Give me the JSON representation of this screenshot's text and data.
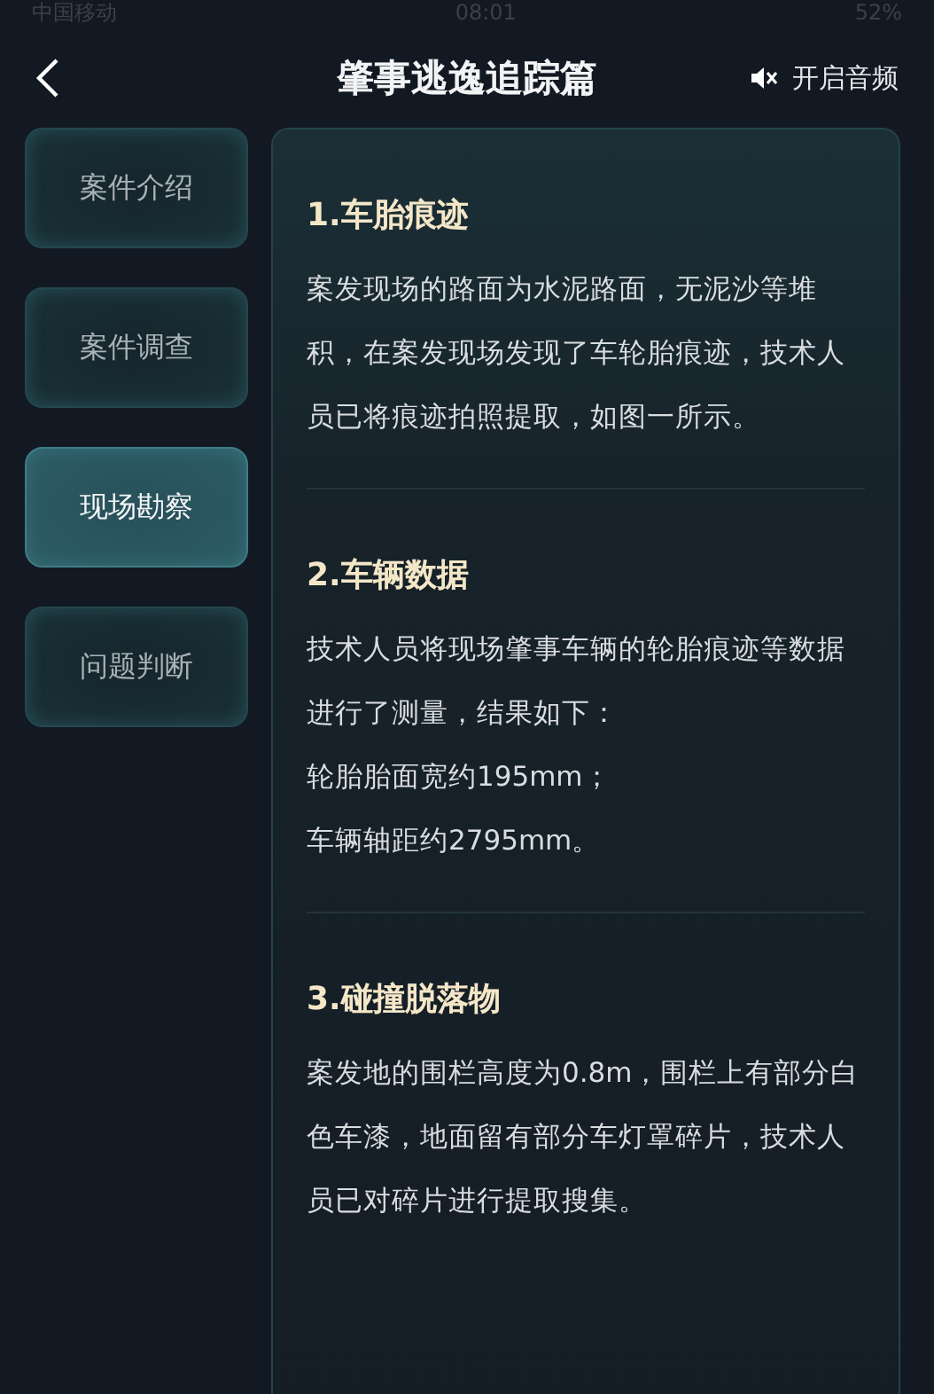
{
  "status_bar": {
    "carrier": "中国移动",
    "time": "08:01",
    "battery": "52%"
  },
  "header": {
    "title": "肇事逃逸追踪篇",
    "audio_label": "开启音频",
    "audio_on": false
  },
  "sidebar": {
    "items": [
      {
        "label": "案件介绍",
        "selected": false
      },
      {
        "label": "案件调查",
        "selected": false
      },
      {
        "label": "现场勘察",
        "selected": true
      },
      {
        "label": "问题判断",
        "selected": false
      }
    ]
  },
  "sections": [
    {
      "title": "1.车胎痕迹",
      "paragraphs": [
        "案发现场的路面为水泥路面，无泥沙等堆积，在案发现场发现了车轮胎痕迹，技术人员已将痕迹拍照提取，如图一所示。"
      ]
    },
    {
      "title": "2.车辆数据",
      "paragraphs": [
        "技术人员将现场肇事车辆的轮胎痕迹等数据进行了测量，结果如下：",
        "轮胎胎面宽约195mm；",
        "车辆轴距约2795mm。"
      ]
    },
    {
      "title": "3.碰撞脱落物",
      "paragraphs": [
        "案发地的围栏高度为0.8m，围栏上有部分白色车漆，地面留有部分车灯罩碎片，技术人员已对碎片进行提取搜集。"
      ]
    }
  ]
}
